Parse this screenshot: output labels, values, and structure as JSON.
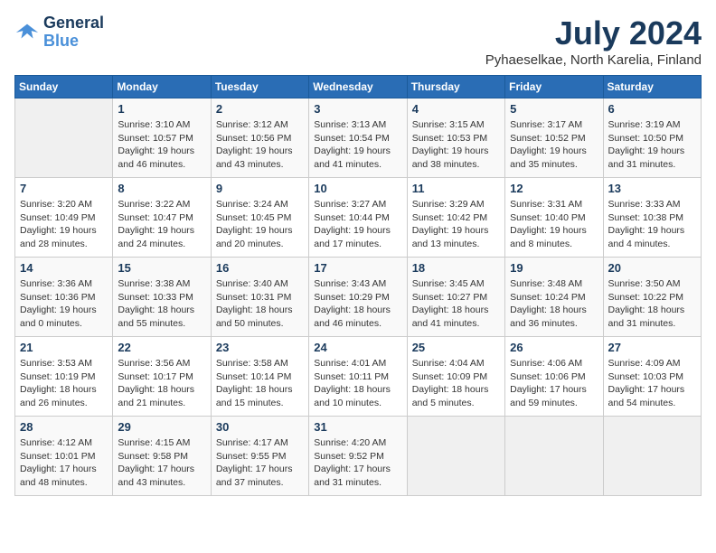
{
  "header": {
    "logo_line1": "General",
    "logo_line2": "Blue",
    "month_year": "July 2024",
    "location": "Pyhaeselkae, North Karelia, Finland"
  },
  "weekdays": [
    "Sunday",
    "Monday",
    "Tuesday",
    "Wednesday",
    "Thursday",
    "Friday",
    "Saturday"
  ],
  "weeks": [
    [
      {
        "day": "",
        "sunrise": "",
        "sunset": "",
        "daylight": ""
      },
      {
        "day": "1",
        "sunrise": "Sunrise: 3:10 AM",
        "sunset": "Sunset: 10:57 PM",
        "daylight": "Daylight: 19 hours and 46 minutes."
      },
      {
        "day": "2",
        "sunrise": "Sunrise: 3:12 AM",
        "sunset": "Sunset: 10:56 PM",
        "daylight": "Daylight: 19 hours and 43 minutes."
      },
      {
        "day": "3",
        "sunrise": "Sunrise: 3:13 AM",
        "sunset": "Sunset: 10:54 PM",
        "daylight": "Daylight: 19 hours and 41 minutes."
      },
      {
        "day": "4",
        "sunrise": "Sunrise: 3:15 AM",
        "sunset": "Sunset: 10:53 PM",
        "daylight": "Daylight: 19 hours and 38 minutes."
      },
      {
        "day": "5",
        "sunrise": "Sunrise: 3:17 AM",
        "sunset": "Sunset: 10:52 PM",
        "daylight": "Daylight: 19 hours and 35 minutes."
      },
      {
        "day": "6",
        "sunrise": "Sunrise: 3:19 AM",
        "sunset": "Sunset: 10:50 PM",
        "daylight": "Daylight: 19 hours and 31 minutes."
      }
    ],
    [
      {
        "day": "7",
        "sunrise": "Sunrise: 3:20 AM",
        "sunset": "Sunset: 10:49 PM",
        "daylight": "Daylight: 19 hours and 28 minutes."
      },
      {
        "day": "8",
        "sunrise": "Sunrise: 3:22 AM",
        "sunset": "Sunset: 10:47 PM",
        "daylight": "Daylight: 19 hours and 24 minutes."
      },
      {
        "day": "9",
        "sunrise": "Sunrise: 3:24 AM",
        "sunset": "Sunset: 10:45 PM",
        "daylight": "Daylight: 19 hours and 20 minutes."
      },
      {
        "day": "10",
        "sunrise": "Sunrise: 3:27 AM",
        "sunset": "Sunset: 10:44 PM",
        "daylight": "Daylight: 19 hours and 17 minutes."
      },
      {
        "day": "11",
        "sunrise": "Sunrise: 3:29 AM",
        "sunset": "Sunset: 10:42 PM",
        "daylight": "Daylight: 19 hours and 13 minutes."
      },
      {
        "day": "12",
        "sunrise": "Sunrise: 3:31 AM",
        "sunset": "Sunset: 10:40 PM",
        "daylight": "Daylight: 19 hours and 8 minutes."
      },
      {
        "day": "13",
        "sunrise": "Sunrise: 3:33 AM",
        "sunset": "Sunset: 10:38 PM",
        "daylight": "Daylight: 19 hours and 4 minutes."
      }
    ],
    [
      {
        "day": "14",
        "sunrise": "Sunrise: 3:36 AM",
        "sunset": "Sunset: 10:36 PM",
        "daylight": "Daylight: 19 hours and 0 minutes."
      },
      {
        "day": "15",
        "sunrise": "Sunrise: 3:38 AM",
        "sunset": "Sunset: 10:33 PM",
        "daylight": "Daylight: 18 hours and 55 minutes."
      },
      {
        "day": "16",
        "sunrise": "Sunrise: 3:40 AM",
        "sunset": "Sunset: 10:31 PM",
        "daylight": "Daylight: 18 hours and 50 minutes."
      },
      {
        "day": "17",
        "sunrise": "Sunrise: 3:43 AM",
        "sunset": "Sunset: 10:29 PM",
        "daylight": "Daylight: 18 hours and 46 minutes."
      },
      {
        "day": "18",
        "sunrise": "Sunrise: 3:45 AM",
        "sunset": "Sunset: 10:27 PM",
        "daylight": "Daylight: 18 hours and 41 minutes."
      },
      {
        "day": "19",
        "sunrise": "Sunrise: 3:48 AM",
        "sunset": "Sunset: 10:24 PM",
        "daylight": "Daylight: 18 hours and 36 minutes."
      },
      {
        "day": "20",
        "sunrise": "Sunrise: 3:50 AM",
        "sunset": "Sunset: 10:22 PM",
        "daylight": "Daylight: 18 hours and 31 minutes."
      }
    ],
    [
      {
        "day": "21",
        "sunrise": "Sunrise: 3:53 AM",
        "sunset": "Sunset: 10:19 PM",
        "daylight": "Daylight: 18 hours and 26 minutes."
      },
      {
        "day": "22",
        "sunrise": "Sunrise: 3:56 AM",
        "sunset": "Sunset: 10:17 PM",
        "daylight": "Daylight: 18 hours and 21 minutes."
      },
      {
        "day": "23",
        "sunrise": "Sunrise: 3:58 AM",
        "sunset": "Sunset: 10:14 PM",
        "daylight": "Daylight: 18 hours and 15 minutes."
      },
      {
        "day": "24",
        "sunrise": "Sunrise: 4:01 AM",
        "sunset": "Sunset: 10:11 PM",
        "daylight": "Daylight: 18 hours and 10 minutes."
      },
      {
        "day": "25",
        "sunrise": "Sunrise: 4:04 AM",
        "sunset": "Sunset: 10:09 PM",
        "daylight": "Daylight: 18 hours and 5 minutes."
      },
      {
        "day": "26",
        "sunrise": "Sunrise: 4:06 AM",
        "sunset": "Sunset: 10:06 PM",
        "daylight": "Daylight: 17 hours and 59 minutes."
      },
      {
        "day": "27",
        "sunrise": "Sunrise: 4:09 AM",
        "sunset": "Sunset: 10:03 PM",
        "daylight": "Daylight: 17 hours and 54 minutes."
      }
    ],
    [
      {
        "day": "28",
        "sunrise": "Sunrise: 4:12 AM",
        "sunset": "Sunset: 10:01 PM",
        "daylight": "Daylight: 17 hours and 48 minutes."
      },
      {
        "day": "29",
        "sunrise": "Sunrise: 4:15 AM",
        "sunset": "Sunset: 9:58 PM",
        "daylight": "Daylight: 17 hours and 43 minutes."
      },
      {
        "day": "30",
        "sunrise": "Sunrise: 4:17 AM",
        "sunset": "Sunset: 9:55 PM",
        "daylight": "Daylight: 17 hours and 37 minutes."
      },
      {
        "day": "31",
        "sunrise": "Sunrise: 4:20 AM",
        "sunset": "Sunset: 9:52 PM",
        "daylight": "Daylight: 17 hours and 31 minutes."
      },
      {
        "day": "",
        "sunrise": "",
        "sunset": "",
        "daylight": ""
      },
      {
        "day": "",
        "sunrise": "",
        "sunset": "",
        "daylight": ""
      },
      {
        "day": "",
        "sunrise": "",
        "sunset": "",
        "daylight": ""
      }
    ]
  ]
}
